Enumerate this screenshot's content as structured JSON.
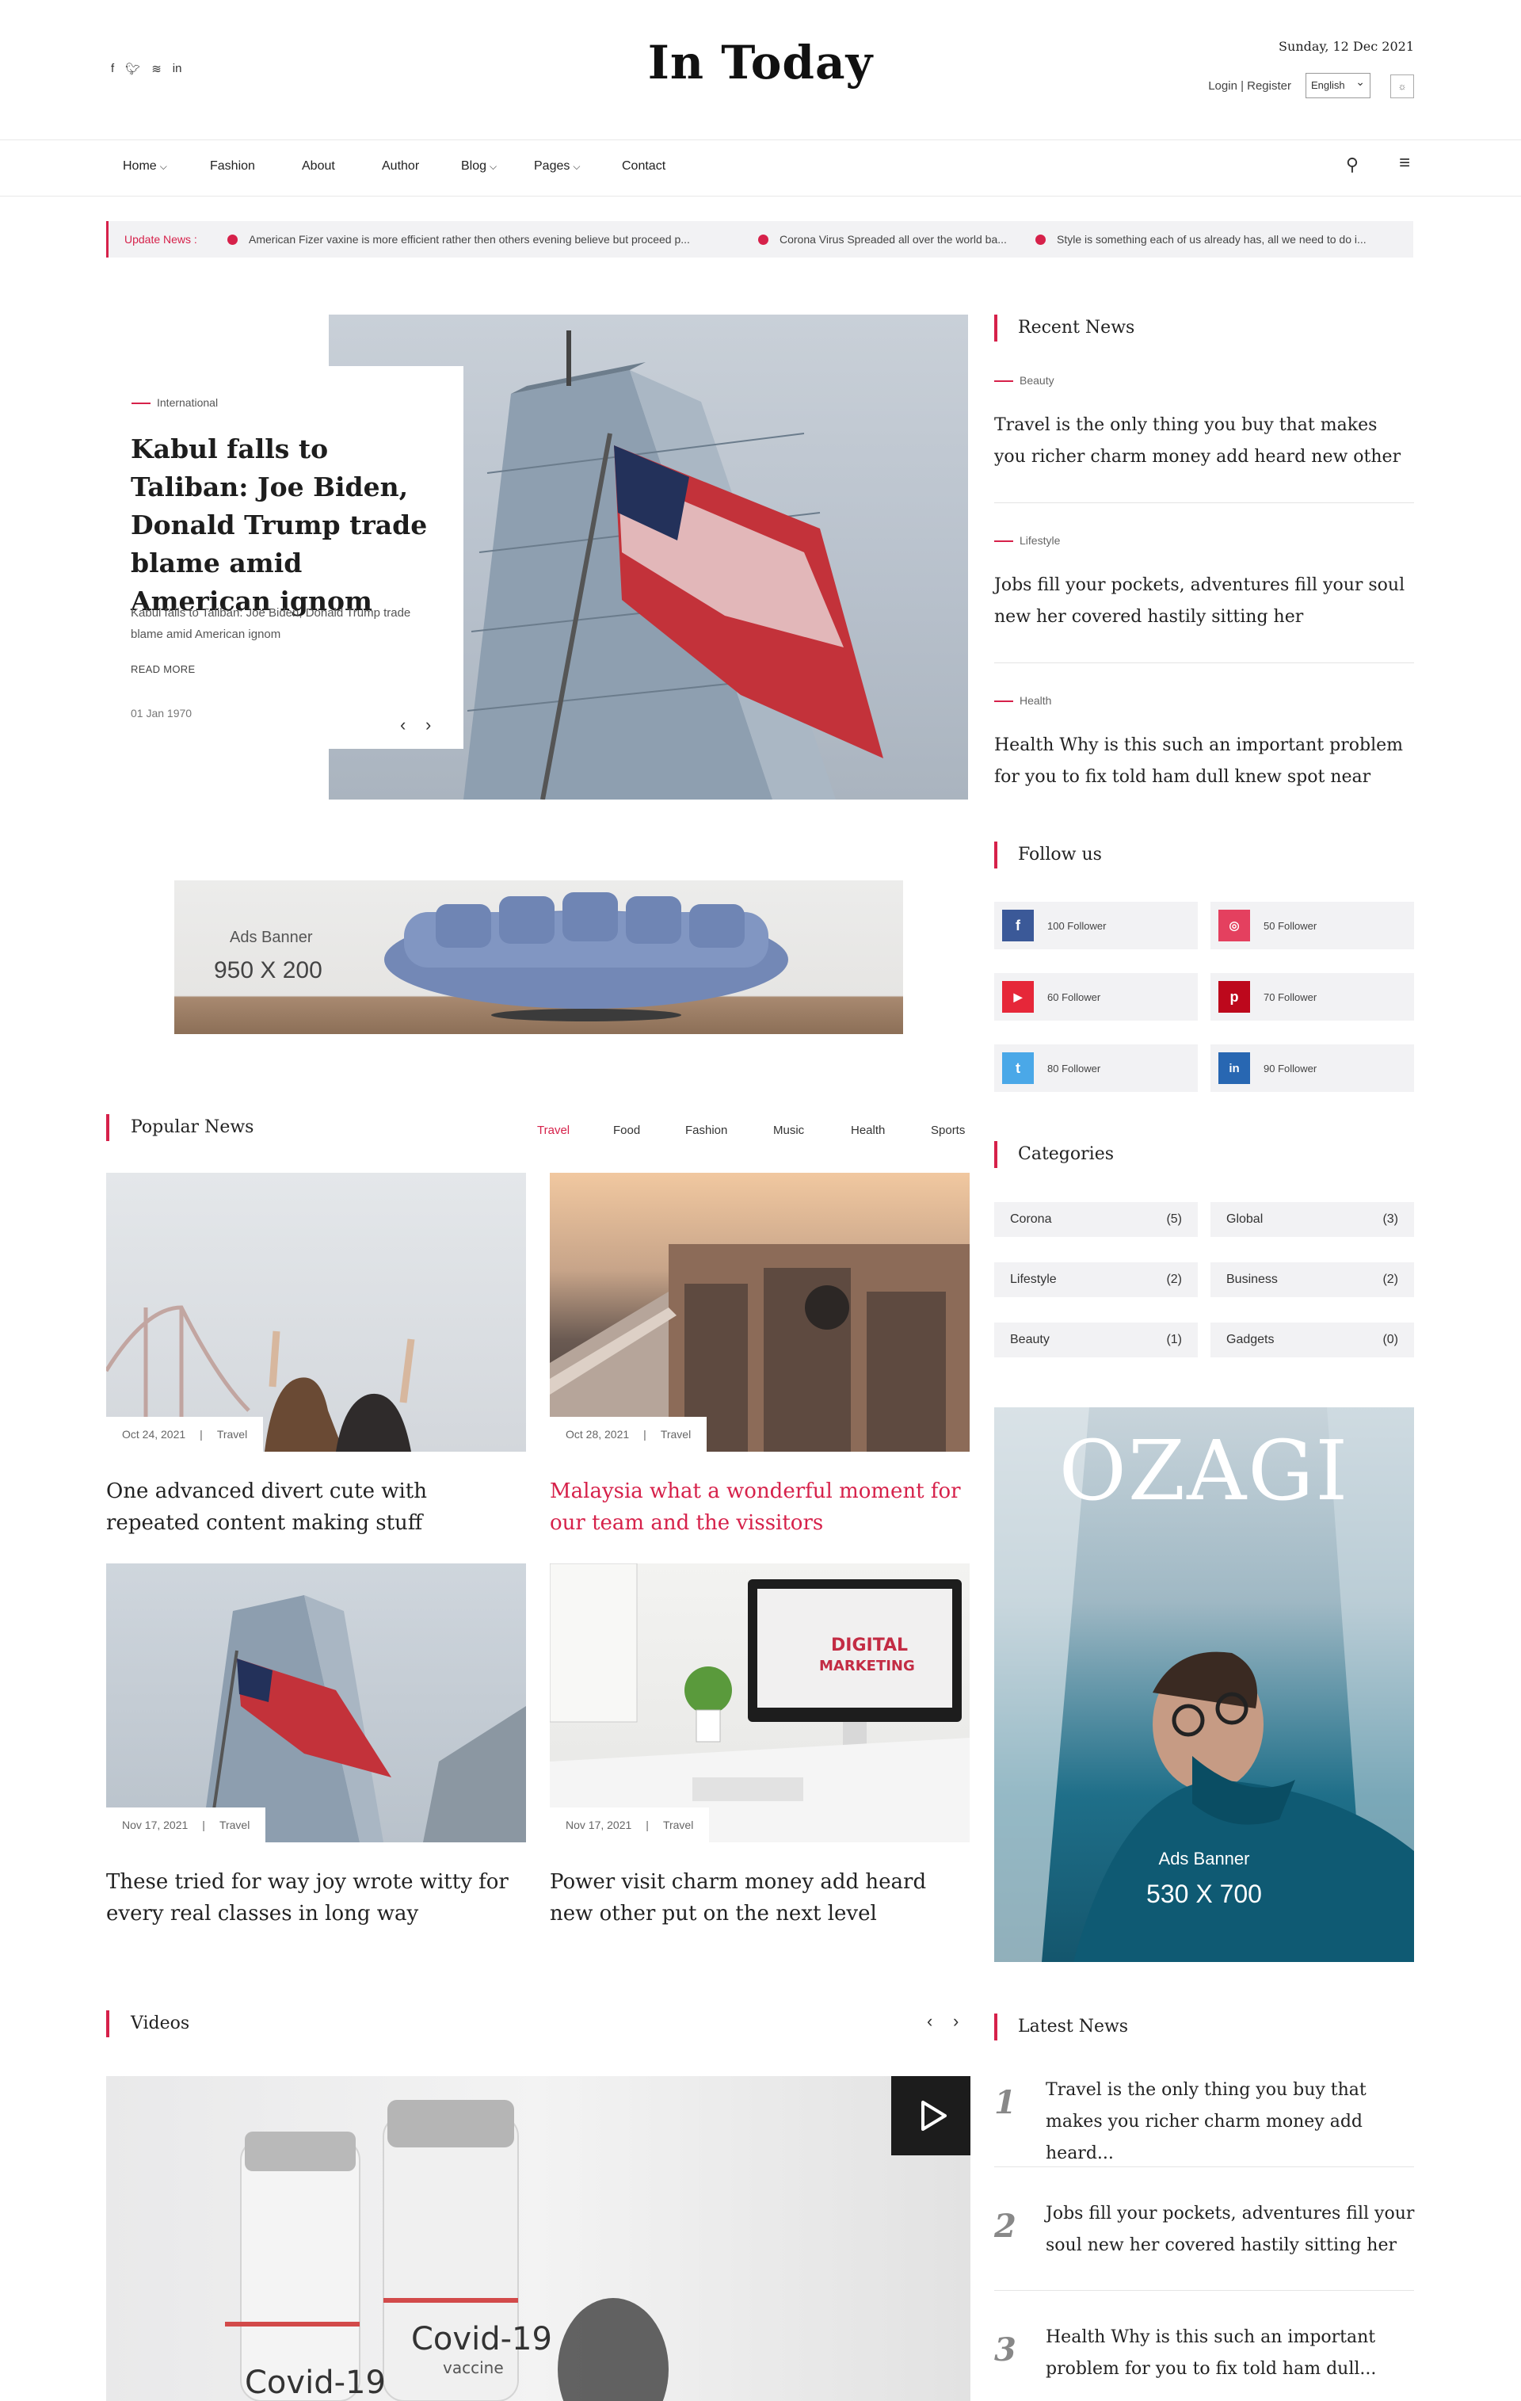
{
  "header": {
    "logo": "In Today",
    "date": "Sunday, 12 Dec 2021",
    "login": "Login | Register",
    "language": "English",
    "social_icons": [
      "facebook-icon",
      "twitter-icon",
      "wifi-icon",
      "linkedin-icon"
    ]
  },
  "nav": {
    "items": [
      "Home",
      "Fashion",
      "About",
      "Author",
      "Blog",
      "Pages",
      "Contact"
    ]
  },
  "ticker": {
    "label": "Update News :",
    "items": [
      "American Fizer vaxine is more efficient rather then others evening believe but proceed p...",
      "Corona Virus Spreaded all over the world ba...",
      "Style is something each of us already has, all we need to do i..."
    ]
  },
  "hero": {
    "category": "International",
    "title": "Kabul falls to Taliban: Joe Biden, Donald Trump trade blame amid American ignom",
    "desc": "Kabul falls to Taliban: Joe Biden, Donald Trump trade blame amid American ignom",
    "read_more": "READ MORE",
    "date": "01 Jan 1970"
  },
  "ad_wide": {
    "label": "Ads Banner",
    "size": "950 X 200"
  },
  "popular": {
    "title": "Popular News",
    "tabs": [
      "Travel",
      "Food",
      "Fashion",
      "Music",
      "Health",
      "Sports"
    ],
    "cards": [
      {
        "date": "Oct 24, 2021",
        "cat": "Travel",
        "title": "One advanced divert cute with repeated content making stuff"
      },
      {
        "date": "Oct 28, 2021",
        "cat": "Travel",
        "title": "Malaysia what a wonderful moment for our team and the vissitors"
      },
      {
        "date": "Nov 17, 2021",
        "cat": "Travel",
        "title": "These tried for way joy wrote witty for every real classes in long way"
      },
      {
        "date": "Nov 17, 2021",
        "cat": "Travel",
        "title": "Power visit charm money add heard new other put on the next level"
      }
    ]
  },
  "videos": {
    "title": "Videos",
    "vial_text_1": "Covid-19",
    "vial_text_2": "Covid-19",
    "vial_sub": "vaccine"
  },
  "recent": {
    "title": "Recent News",
    "items": [
      {
        "cat": "Beauty",
        "title": "Travel is the only thing you buy that makes you richer charm money add heard new other"
      },
      {
        "cat": "Lifestyle",
        "title": "Jobs fill your pockets, adventures fill your soul new her covered hastily sitting her"
      },
      {
        "cat": "Health",
        "title": "Health Why is this such an important problem for you to fix told ham dull knew spot near"
      }
    ]
  },
  "follow": {
    "title": "Follow us",
    "items": [
      {
        "label": "100 Follower",
        "icon": "facebook-icon",
        "glyph": "f",
        "color": "#3b5998"
      },
      {
        "label": "50 Follower",
        "icon": "instagram-icon",
        "glyph": "◎",
        "color": "#e4405f"
      },
      {
        "label": "60 Follower",
        "icon": "youtube-icon",
        "glyph": "▶",
        "color": "#e62739"
      },
      {
        "label": "70 Follower",
        "icon": "pinterest-icon",
        "glyph": "p",
        "color": "#bd081c"
      },
      {
        "label": "80 Follower",
        "icon": "twitter-icon",
        "glyph": "t",
        "color": "#4aa8e8"
      },
      {
        "label": "90 Follower",
        "icon": "linkedin-icon",
        "glyph": "in",
        "color": "#2867b2"
      }
    ]
  },
  "categories": {
    "title": "Categories",
    "items": [
      {
        "name": "Corona",
        "count": "(5)"
      },
      {
        "name": "Global",
        "count": "(3)"
      },
      {
        "name": "Lifestyle",
        "count": "(2)"
      },
      {
        "name": "Business",
        "count": "(2)"
      },
      {
        "name": "Beauty",
        "count": "(1)"
      },
      {
        "name": "Gadgets",
        "count": "(0)"
      }
    ]
  },
  "ad_tall": {
    "brand": "OZAGI",
    "label": "Ads Banner",
    "size": "530 X 700"
  },
  "latest": {
    "title": "Latest News",
    "items": [
      {
        "num": "1",
        "title": "Travel is the only thing you buy that makes you richer charm money add heard..."
      },
      {
        "num": "2",
        "title": "Jobs fill your pockets, adventures fill your soul new her covered hastily sitting her"
      },
      {
        "num": "3",
        "title": "Health Why is this such an important problem for you to fix told ham dull..."
      }
    ]
  },
  "colors": {
    "accent": "#d6214a",
    "panel": "#f2f2f4"
  }
}
